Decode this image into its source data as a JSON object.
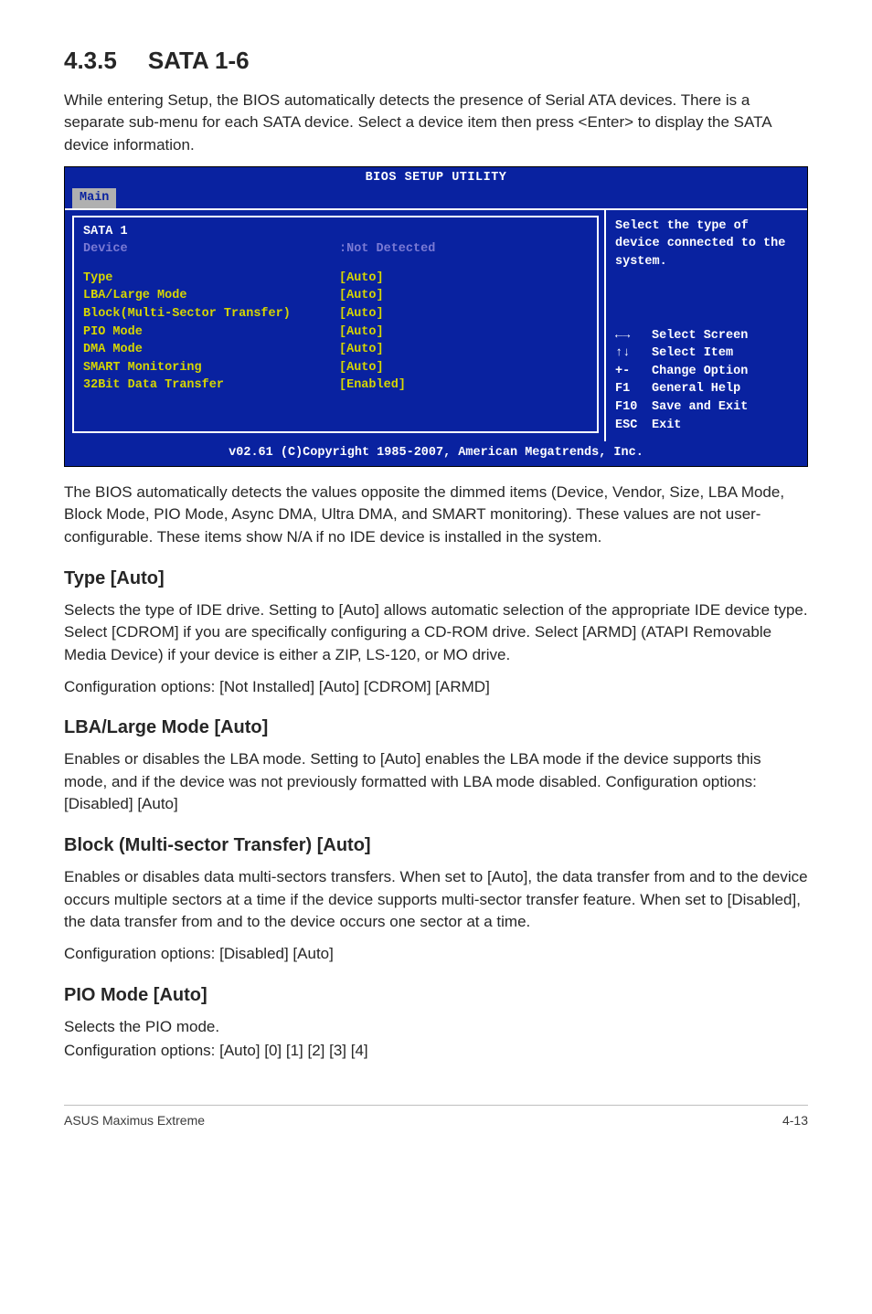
{
  "section": {
    "number": "4.3.5",
    "title": "SATA 1-6",
    "intro": "While entering Setup, the BIOS automatically detects the presence of Serial ATA devices. There is a separate sub-menu for each SATA device. Select a device item then press <Enter> to display the SATA device information."
  },
  "bios": {
    "title": "BIOS SETUP UTILITY",
    "tab": "Main",
    "panel_header": "SATA 1",
    "device_label": "Device",
    "device_value": ":Not Detected",
    "rows": [
      {
        "label": "Type",
        "value": "[Auto]"
      },
      {
        "label": "LBA/Large Mode",
        "value": "[Auto]"
      },
      {
        "label": "Block(Multi-Sector Transfer)",
        "value": "[Auto]"
      },
      {
        "label": "PIO Mode",
        "value": "[Auto]"
      },
      {
        "label": "DMA Mode",
        "value": "[Auto]"
      },
      {
        "label": "SMART Monitoring",
        "value": "[Auto]"
      },
      {
        "label": "32Bit Data Transfer",
        "value": "[Enabled]"
      }
    ],
    "help": "Select the type of device connected to the system.",
    "keys": [
      {
        "k": "←→",
        "d": "Select Screen"
      },
      {
        "k": "↑↓",
        "d": "Select Item"
      },
      {
        "k": "+-",
        "d": "Change Option"
      },
      {
        "k": "F1",
        "d": "General Help"
      },
      {
        "k": "F10",
        "d": "Save and Exit"
      },
      {
        "k": "ESC",
        "d": "Exit"
      }
    ],
    "footer": "v02.61 (C)Copyright 1985-2007, American Megatrends, Inc."
  },
  "after_bios": "The BIOS automatically detects the values opposite the dimmed items (Device, Vendor, Size, LBA Mode, Block Mode, PIO Mode, Async DMA, Ultra DMA, and SMART monitoring). These values are not user-configurable. These items show N/A if no IDE device is installed in the system.",
  "type_section": {
    "heading": "Type [Auto]",
    "p1": "Selects the type of IDE drive. Setting to [Auto] allows automatic selection of the appropriate IDE device type. Select [CDROM] if you are specifically configuring a CD-ROM drive. Select [ARMD] (ATAPI Removable Media Device) if your device is either a ZIP, LS-120, or MO drive.",
    "p2": "Configuration options: [Not Installed] [Auto] [CDROM] [ARMD]"
  },
  "lba_section": {
    "heading": "LBA/Large Mode [Auto]",
    "p1": "Enables or disables the LBA mode. Setting to [Auto] enables the LBA mode if the device supports this mode, and if the device was not previously formatted with LBA mode disabled. Configuration options: [Disabled] [Auto]"
  },
  "block_section": {
    "heading": "Block (Multi-sector Transfer) [Auto]",
    "p1": "Enables or disables data multi-sectors transfers. When set to [Auto], the data transfer from and to the device occurs multiple sectors at a time if the device supports multi-sector transfer feature. When set to [Disabled], the data transfer from and to the device occurs one sector at a time.",
    "p2": "Configuration options: [Disabled] [Auto]"
  },
  "pio_section": {
    "heading": "PIO Mode [Auto]",
    "p1": "Selects the PIO mode.",
    "p2": "Configuration options: [Auto] [0] [1] [2] [3] [4]"
  },
  "footer": {
    "left": "ASUS Maximus Extreme",
    "right": "4-13"
  }
}
